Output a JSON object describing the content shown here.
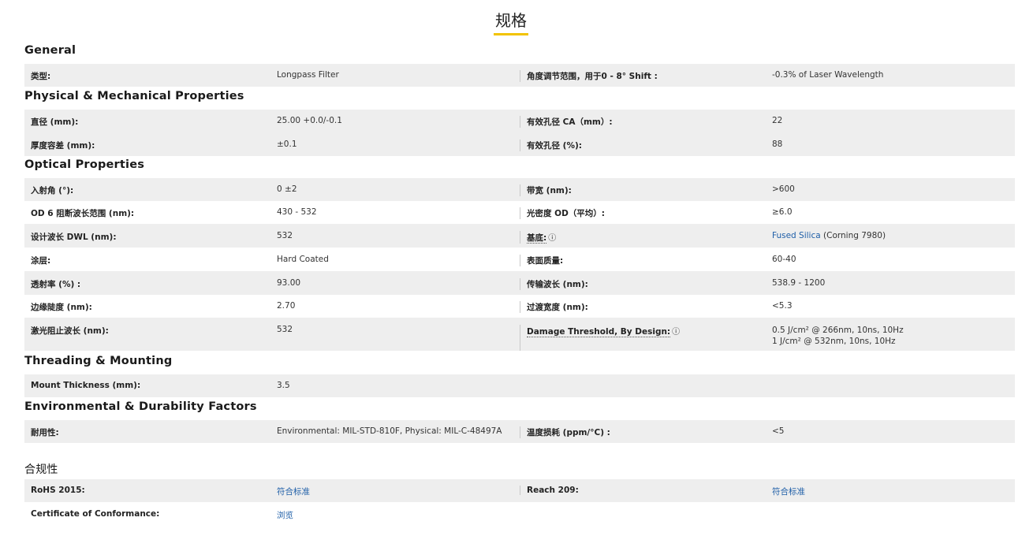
{
  "page_title": "规格",
  "sections": {
    "general": {
      "heading": "General",
      "rows": [
        {
          "label1": "类型:",
          "value1": "Longpass Filter",
          "label2": "角度调节范围，用于0 - 8° Shift :",
          "value2": "-0.3% of Laser Wavelength"
        }
      ]
    },
    "physical": {
      "heading": "Physical & Mechanical Properties",
      "rows": [
        {
          "label1": "直径 (mm):",
          "value1": "25.00 +0.0/-0.1",
          "label2": "有效孔径 CA（mm）:",
          "value2": "22"
        },
        {
          "label1": "厚度容差 (mm):",
          "value1": "±0.1",
          "label2": "有效孔径 (%):",
          "value2": "88"
        }
      ]
    },
    "optical": {
      "heading": "Optical Properties",
      "rows": [
        {
          "label1": "入射角 (°):",
          "value1": "0 ±2",
          "label2": "带宽 (nm):",
          "value2": ">600"
        },
        {
          "label1": "OD 6 阻断波长范围 (nm):",
          "value1": "430 - 532",
          "label2": "光密度 OD（平均）:",
          "value2": "≥6.0"
        },
        {
          "label1": "设计波长 DWL (nm):",
          "value1": "532",
          "label2": "基底:",
          "value2_link": "Fused Silica",
          "value2_rest": " (Corning 7980)"
        },
        {
          "label1": "涂层:",
          "value1": "Hard Coated",
          "label2": "表面质量:",
          "value2": "60-40"
        },
        {
          "label1": "透射率 (%) :",
          "value1": "93.00",
          "label2": "传输波长 (nm):",
          "value2": "538.9 - 1200"
        },
        {
          "label1": "边缘陡度 (nm):",
          "value1": "2.70",
          "label2": "过渡宽度 (nm):",
          "value2": "<5.3"
        },
        {
          "label1": "激光阻止波长 (nm):",
          "value1": "532",
          "label2": "Damage Threshold, By Design:",
          "value2_line1": "0.5 J/cm² @ 266nm, 10ns, 10Hz",
          "value2_line2": "1 J/cm² @ 532nm, 10ns, 10Hz"
        }
      ]
    },
    "threading": {
      "heading": "Threading & Mounting",
      "rows": [
        {
          "label1": "Mount Thickness (mm):",
          "value1": "3.5"
        }
      ]
    },
    "environmental": {
      "heading": "Environmental & Durability Factors",
      "rows": [
        {
          "label1": "耐用性:",
          "value1": "Environmental: MIL-STD-810F, Physical: MIL-C-48497A",
          "label2": "温度损耗 (ppm/°C) :",
          "value2": "<5"
        }
      ]
    },
    "compliance": {
      "heading": "合规性",
      "rows": [
        {
          "label1": "RoHS 2015:",
          "value1": "符合标准",
          "label2": "Reach 209:",
          "value2": "符合标准"
        },
        {
          "label1": "Certificate of Conformance:",
          "value1": "浏览"
        }
      ]
    }
  },
  "icons": {
    "info": "ⓘ"
  },
  "colors": {
    "accent": "#f2c300",
    "link": "#1f5fa8",
    "row_shade": "#eeeeee"
  }
}
